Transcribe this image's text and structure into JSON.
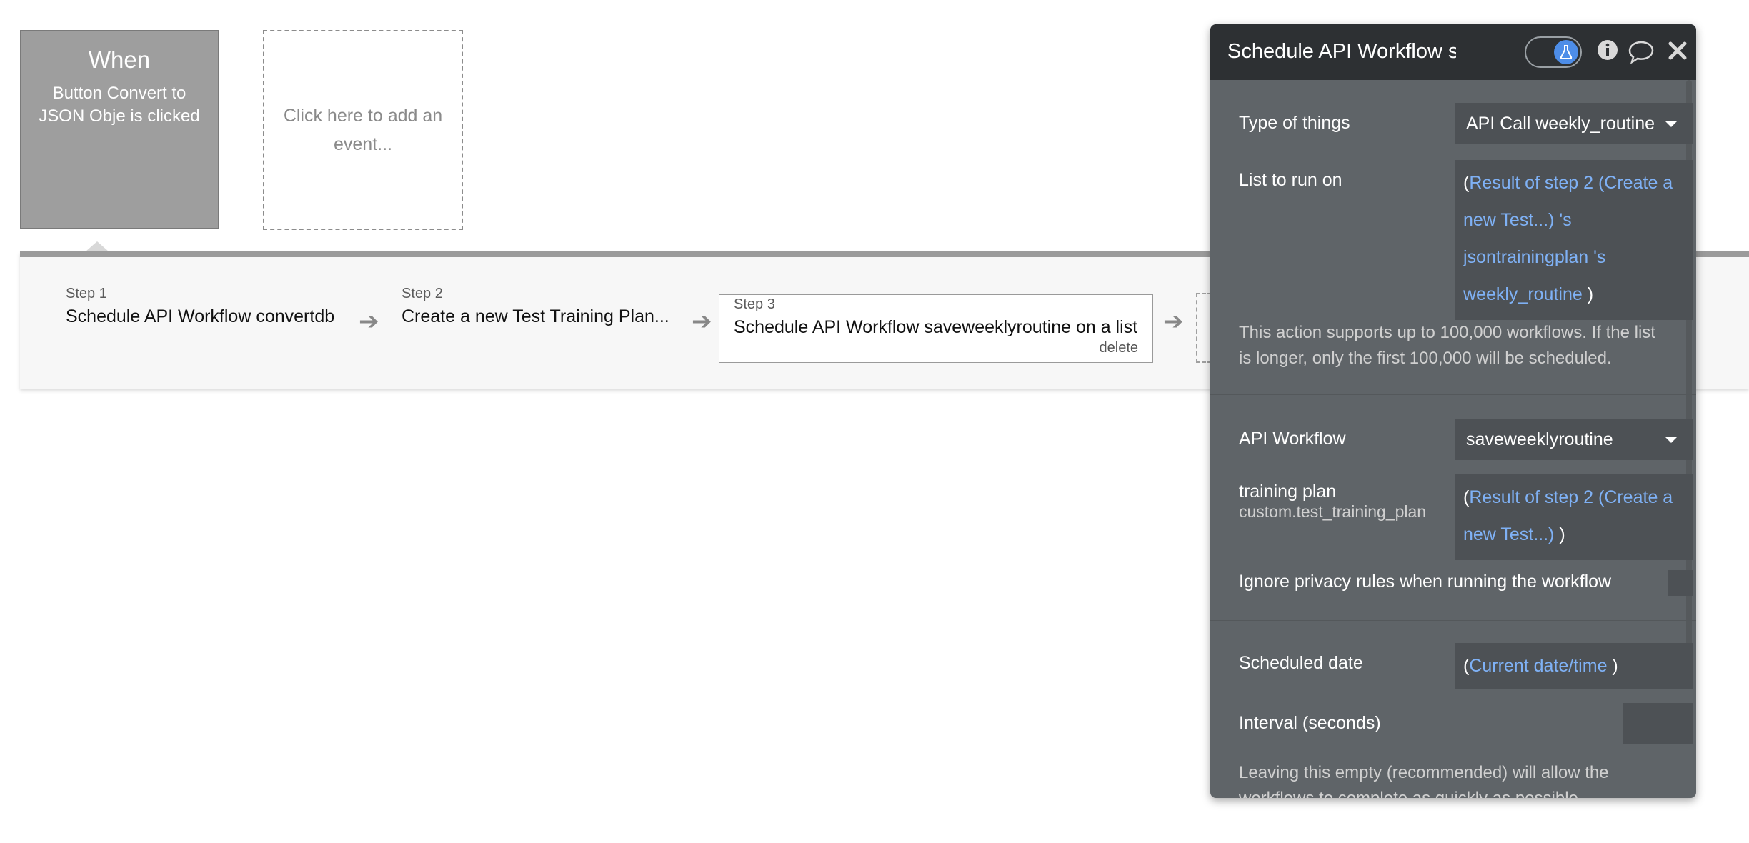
{
  "event": {
    "when_label": "When",
    "description": "Button Convert to JSON Obje is clicked",
    "add_event_label": "Click here to add an event..."
  },
  "steps": [
    {
      "label": "Step 1",
      "title": "Schedule API Workflow convertdb"
    },
    {
      "label": "Step 2",
      "title": "Create a new Test Training Plan..."
    },
    {
      "label": "Step 3",
      "title": "Schedule API Workflow saveweeklyroutine on a list",
      "delete_label": "delete"
    }
  ],
  "panel": {
    "title": "Schedule API Workflow s",
    "type_of_things": {
      "label": "Type of things",
      "value": "API Call weekly_routine"
    },
    "list_to_run_on": {
      "label": "List to run on",
      "expr_open": "(",
      "expr_text": "Result of step 2 (Create a new Test...) 's jsontrainingplan 's weekly_routine",
      "expr_close": ")"
    },
    "list_note": "This action supports up to 100,000 workflows. If the list is longer, only the first 100,000 will be scheduled.",
    "api_workflow": {
      "label": "API Workflow",
      "value": "saveweeklyroutine"
    },
    "training_plan": {
      "label": "training plan",
      "sublabel": "custom.test_training_plan",
      "expr_open": "(",
      "expr_text": "Result of step 2 (Create a new Test...)",
      "expr_close": ")"
    },
    "ignore_privacy": {
      "label": "Ignore privacy rules when running the workflow",
      "checked": false
    },
    "scheduled_date": {
      "label": "Scheduled date",
      "expr_open": "(",
      "expr_text": "Current date/time",
      "expr_close": ")"
    },
    "interval": {
      "label": "Interval (seconds)",
      "value": ""
    },
    "interval_note": "Leaving this empty (recommended) will allow the workflows to complete as quickly as possible."
  },
  "colors": {
    "dynamic_expression": "#7fb1f5",
    "panel_bg": "#5f6468",
    "header_bg": "#2d3033",
    "toggle_accent": "#4d8de8"
  },
  "icons": {
    "toggle": "flask-icon",
    "info": "info-icon",
    "comment": "comment-icon",
    "close": "close-icon",
    "arrow": "arrow-right-icon",
    "dropdown": "chevron-down-icon"
  }
}
